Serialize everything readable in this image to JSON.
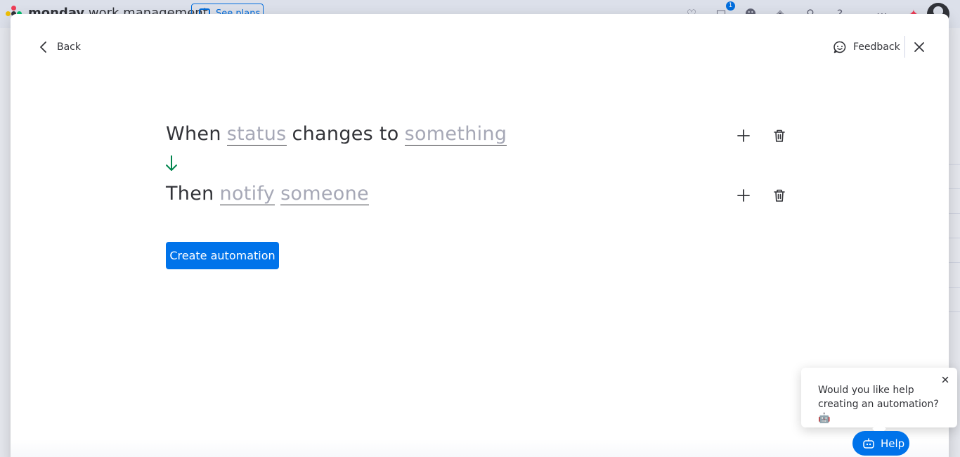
{
  "app": {
    "brand_bold": "monday",
    "brand_rest": "work management",
    "see_plans_label": "See plans",
    "notification_count": "1"
  },
  "modal": {
    "back_label": "Back",
    "feedback_label": "Feedback"
  },
  "recipe": {
    "trigger": {
      "when": "When",
      "field": "status",
      "middle": "changes to",
      "value": "something"
    },
    "action": {
      "then": "Then",
      "verb": "notify",
      "target": "someone"
    }
  },
  "create_button_label": "Create automation",
  "help_tooltip": {
    "text": "Would you like help creating an automation? 🤖"
  },
  "help_button_label": "Help",
  "colors": {
    "primary": "#0073ea",
    "arrow": "#00854d",
    "placeholder": "#a6a8b6"
  }
}
